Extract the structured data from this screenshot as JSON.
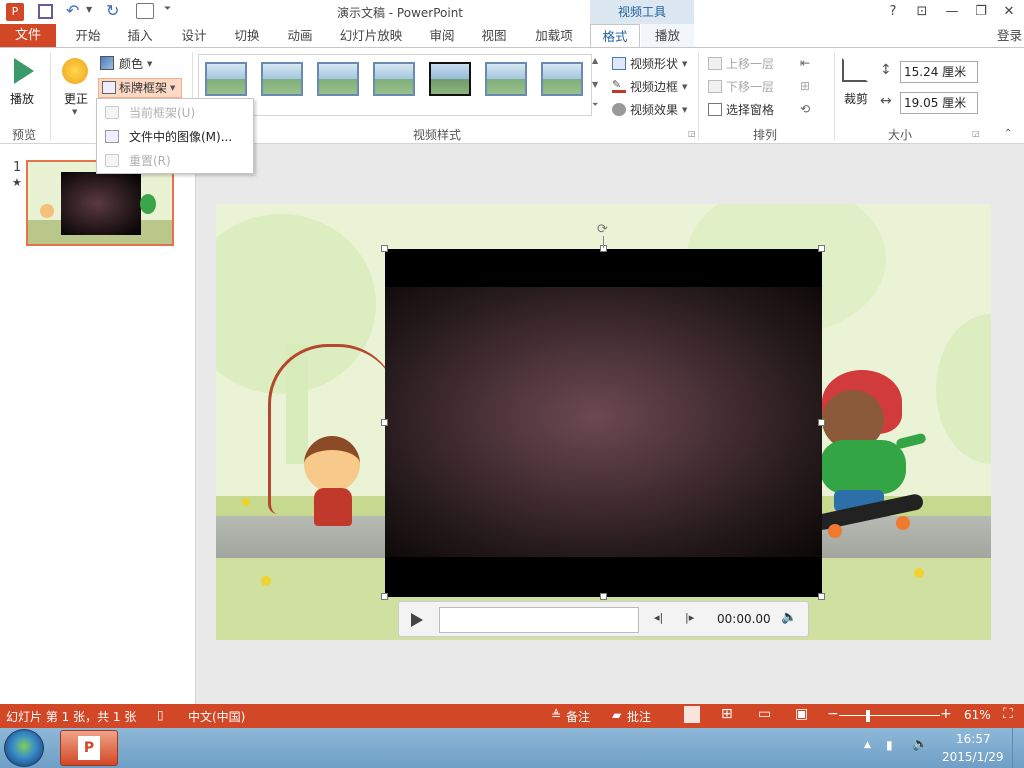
{
  "app": {
    "title": "演示文稿 - PowerPoint",
    "context_tab_group": "视频工具",
    "login": "登录",
    "window_controls": [
      "?",
      "restore-ribbon",
      "minimize",
      "maximize",
      "close"
    ]
  },
  "quick_access": [
    "ppt-logo-icon",
    "save-icon",
    "undo-icon",
    "redo-icon",
    "start-from-beginning-icon",
    "customize-icon"
  ],
  "tabs": [
    {
      "label": "文件"
    },
    {
      "label": "开始"
    },
    {
      "label": "插入"
    },
    {
      "label": "设计"
    },
    {
      "label": "切换"
    },
    {
      "label": "动画"
    },
    {
      "label": "幻灯片放映"
    },
    {
      "label": "审阅"
    },
    {
      "label": "视图"
    },
    {
      "label": "加载项"
    },
    {
      "label": "格式"
    },
    {
      "label": "播放"
    }
  ],
  "ribbon": {
    "preview": {
      "play_label": "播放",
      "group": "预览"
    },
    "adjust": {
      "correct_label": "更正",
      "color_label": "颜色",
      "poster_label": "标牌框架"
    },
    "video_styles": {
      "group": "视频样式",
      "shape_label": "视频形状",
      "border_label": "视频边框",
      "effects_label": "视频效果"
    },
    "arrange": {
      "group": "排列",
      "bring_forward": "上移一层",
      "send_backward": "下移一层",
      "selection_pane": "选择窗格"
    },
    "size": {
      "group": "大小",
      "crop_label": "裁剪",
      "height": "15.24 厘米",
      "width": "19.05 厘米"
    }
  },
  "dropdown": {
    "items": [
      {
        "label": "当前框架(U)",
        "disabled": true
      },
      {
        "label": "文件中的图像(M)...",
        "disabled": false
      },
      {
        "label": "重置(R)",
        "disabled": true
      }
    ]
  },
  "slides_pane": {
    "number": "1",
    "star": "★"
  },
  "video": {
    "time": "00:00.00"
  },
  "statusbar": {
    "slide_info": "幻灯片 第 1 张，共 1 张",
    "language": "中文(中国)",
    "notes": "备注",
    "comments": "批注",
    "zoom": "61%"
  },
  "taskbar": {
    "time": "16:57",
    "date": "2015/1/29"
  },
  "colors": {
    "accent": "#d24726",
    "context_tab": "#dce7f1",
    "context_text": "#1f5f9e"
  }
}
